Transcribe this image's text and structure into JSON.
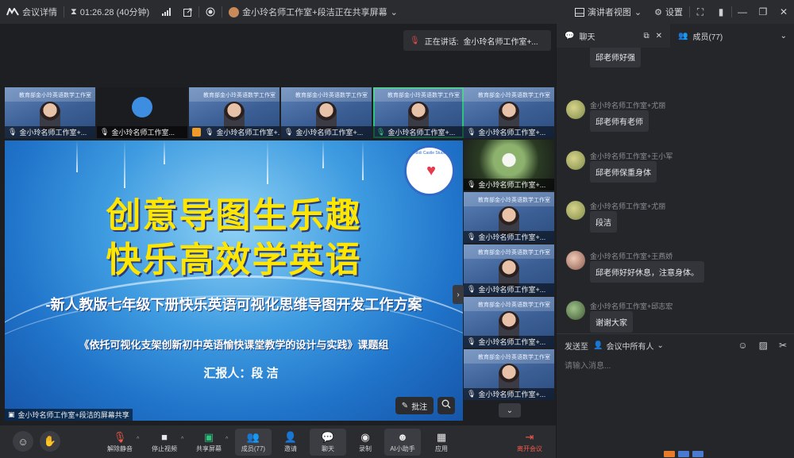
{
  "topbar": {
    "meeting_info": "会议详情",
    "timer": "01:26.28 (40分钟)",
    "share_status": "金小玲名师工作室+段洁正在共享屏幕",
    "view_mode": "演讲者视图",
    "settings": "设置"
  },
  "speaking": {
    "prefix": "正在讲话:",
    "name": "金小玲名师工作室+..."
  },
  "tiles": [
    {
      "label": "金小玲名师工作室+..."
    },
    {
      "label": "金小玲名师工作室..."
    },
    {
      "label": "金小玲名师工作室+..."
    },
    {
      "label": "金小玲名师工作室+..."
    },
    {
      "label": "金小玲名师工作室+..."
    },
    {
      "label": "金小玲名师工作室+..."
    }
  ],
  "side_tiles": [
    {
      "label": "金小玲名师工作室+..."
    },
    {
      "label": "金小玲名师工作室+..."
    },
    {
      "label": "金小玲名师工作室+..."
    },
    {
      "label": "金小玲名师工作室+..."
    },
    {
      "label": "金小玲名师工作室+..."
    }
  ],
  "slide": {
    "title_line1": "创意导图生乐趣",
    "title_line2": "快乐高效学英语",
    "subtitle": "-新人教版七年级下册快乐英语可视化思维导图开发工作方案",
    "project": "《依托可视化支架创新初中英语愉快课堂教学的设计与实践》课题组",
    "reporter": "汇报人：段 洁",
    "share_label": "金小玲名师工作室+段洁的屏幕共享"
  },
  "annotate_label": "批注",
  "toolbar": {
    "unmute": "解除静音",
    "stop_video": "停止视频",
    "share_screen": "共享屏幕",
    "members": "成员(77)",
    "invite": "邀请",
    "chat": "聊天",
    "record": "录制",
    "ai_assistant": "AI小助手",
    "apps": "应用",
    "leave": "离开会议"
  },
  "panel": {
    "chat_tab": "聊天",
    "members_tab": "成员(77)",
    "messages": [
      {
        "sender": "",
        "text": "邱老师好强"
      },
      {
        "sender": "金小玲名师工作室+尤丽",
        "text": "邱老师有老师"
      },
      {
        "sender": "金小玲名师工作室+王小军",
        "text": "邱老师保重身体"
      },
      {
        "sender": "金小玲名师工作室+尤丽",
        "text": "段洁"
      },
      {
        "sender": "金小玲名师工作室+王燕娇",
        "text": "邱老师好好休息，注意身体。"
      },
      {
        "sender": "金小玲名师工作室+邱志宏",
        "text": "谢谢大家"
      }
    ],
    "send_to_label": "发送至",
    "send_to_value": "会议中所有人",
    "input_placeholder": "请输入消息..."
  },
  "colors": {
    "accent_red": "#f05a4b",
    "active_tile": "#2ec27e",
    "slide_title": "#ffe600"
  }
}
